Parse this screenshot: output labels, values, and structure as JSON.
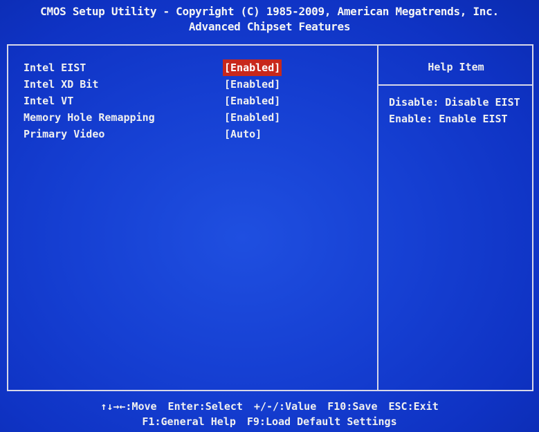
{
  "header": {
    "title_line1": "CMOS Setup Utility - Copyright (C) 1985-2009, American Megatrends, Inc.",
    "title_line2": "Advanced Chipset Features"
  },
  "settings": [
    {
      "label": "Intel EIST",
      "value": "[Enabled]",
      "selected": true
    },
    {
      "label": "Intel XD Bit",
      "value": "[Enabled]",
      "selected": false
    },
    {
      "label": "Intel VT",
      "value": "[Enabled]",
      "selected": false
    },
    {
      "label": "Memory Hole Remapping",
      "value": "[Enabled]",
      "selected": false
    },
    {
      "label": "Primary Video",
      "value": "[Auto]",
      "selected": false
    }
  ],
  "help": {
    "title": "Help Item",
    "lines": [
      "Disable: Disable EIST",
      "Enable:  Enable EIST"
    ]
  },
  "footer": {
    "row1": [
      "↑↓→←:Move",
      "Enter:Select",
      "+/-/:Value",
      "F10:Save",
      "ESC:Exit"
    ],
    "row2": [
      "F1:General Help",
      "F9:Load Default Settings"
    ]
  },
  "colors": {
    "background": "#1640d3",
    "highlight": "#c8281c",
    "text": "#f0f0f0"
  }
}
